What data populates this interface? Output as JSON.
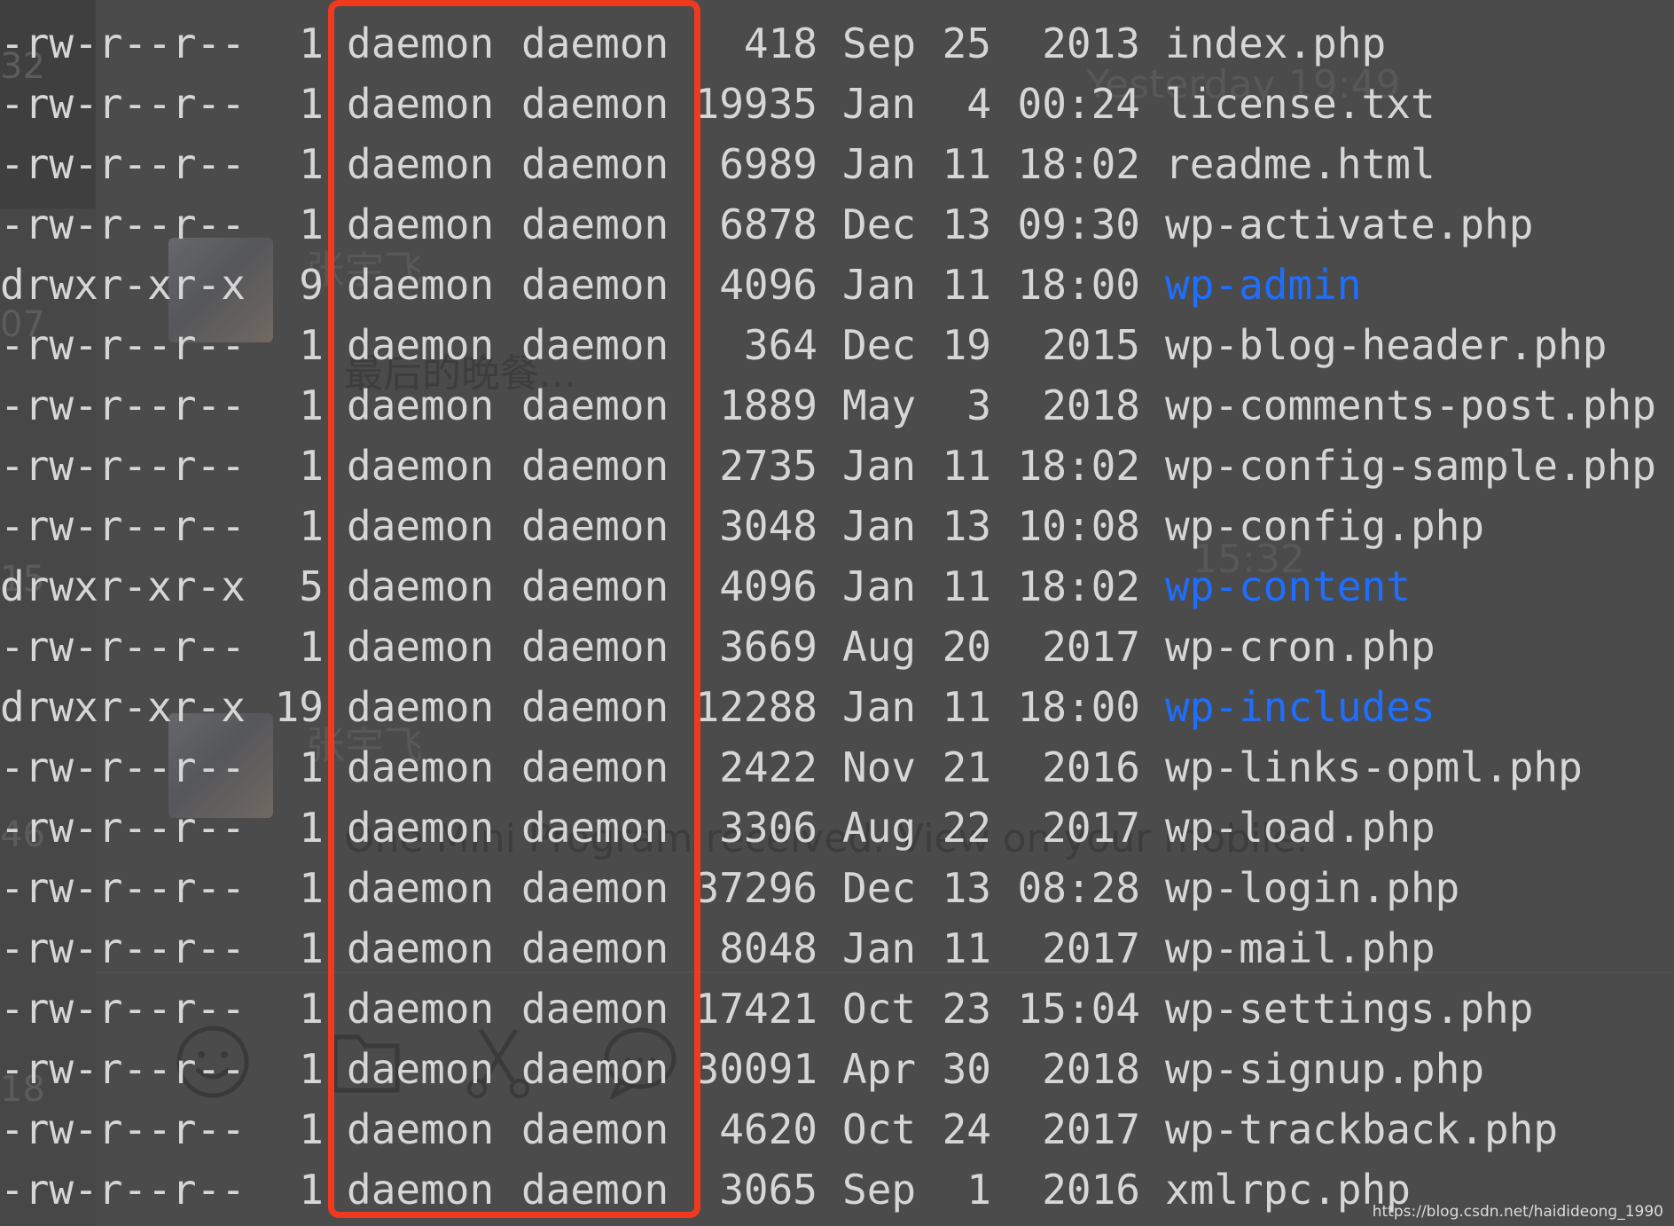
{
  "colors": {
    "background": "#4b4b4b",
    "text": "#d6d6d6",
    "directory": "#1f6fff",
    "highlight_box": "#f0391f"
  },
  "background_ui": {
    "sidebar_numbers": [
      "32",
      "07",
      "15",
      "46",
      "18"
    ],
    "chat_time_1": "Yesterday 19:49",
    "chat_time_2": "15:32",
    "sender_name_1": "张宇飞",
    "sender_name_2": "张宇飞",
    "message_preview": "最后的晚餐...",
    "mini_program_notice": "One Mini Program received. View on your mobile.",
    "toolbar_icons": [
      "emoji-icon",
      "folder-icon",
      "scissors-icon",
      "chat-bubble-icon"
    ]
  },
  "listing": [
    {
      "perm": "-rw-r--r--",
      "links": "1",
      "owner": "daemon",
      "group": "daemon",
      "size": "418",
      "month": "Sep",
      "day": "25",
      "time": "2013",
      "name": "index.php",
      "is_dir": false
    },
    {
      "perm": "-rw-r--r--",
      "links": "1",
      "owner": "daemon",
      "group": "daemon",
      "size": "19935",
      "month": "Jan",
      "day": "4",
      "time": "00:24",
      "name": "license.txt",
      "is_dir": false
    },
    {
      "perm": "-rw-r--r--",
      "links": "1",
      "owner": "daemon",
      "group": "daemon",
      "size": "6989",
      "month": "Jan",
      "day": "11",
      "time": "18:02",
      "name": "readme.html",
      "is_dir": false
    },
    {
      "perm": "-rw-r--r--",
      "links": "1",
      "owner": "daemon",
      "group": "daemon",
      "size": "6878",
      "month": "Dec",
      "day": "13",
      "time": "09:30",
      "name": "wp-activate.php",
      "is_dir": false
    },
    {
      "perm": "drwxr-xr-x",
      "links": "9",
      "owner": "daemon",
      "group": "daemon",
      "size": "4096",
      "month": "Jan",
      "day": "11",
      "time": "18:00",
      "name": "wp-admin",
      "is_dir": true
    },
    {
      "perm": "-rw-r--r--",
      "links": "1",
      "owner": "daemon",
      "group": "daemon",
      "size": "364",
      "month": "Dec",
      "day": "19",
      "time": "2015",
      "name": "wp-blog-header.php",
      "is_dir": false
    },
    {
      "perm": "-rw-r--r--",
      "links": "1",
      "owner": "daemon",
      "group": "daemon",
      "size": "1889",
      "month": "May",
      "day": "3",
      "time": "2018",
      "name": "wp-comments-post.php",
      "is_dir": false
    },
    {
      "perm": "-rw-r--r--",
      "links": "1",
      "owner": "daemon",
      "group": "daemon",
      "size": "2735",
      "month": "Jan",
      "day": "11",
      "time": "18:02",
      "name": "wp-config-sample.php",
      "is_dir": false
    },
    {
      "perm": "-rw-r--r--",
      "links": "1",
      "owner": "daemon",
      "group": "daemon",
      "size": "3048",
      "month": "Jan",
      "day": "13",
      "time": "10:08",
      "name": "wp-config.php",
      "is_dir": false
    },
    {
      "perm": "drwxr-xr-x",
      "links": "5",
      "owner": "daemon",
      "group": "daemon",
      "size": "4096",
      "month": "Jan",
      "day": "11",
      "time": "18:02",
      "name": "wp-content",
      "is_dir": true
    },
    {
      "perm": "-rw-r--r--",
      "links": "1",
      "owner": "daemon",
      "group": "daemon",
      "size": "3669",
      "month": "Aug",
      "day": "20",
      "time": "2017",
      "name": "wp-cron.php",
      "is_dir": false
    },
    {
      "perm": "drwxr-xr-x",
      "links": "19",
      "owner": "daemon",
      "group": "daemon",
      "size": "12288",
      "month": "Jan",
      "day": "11",
      "time": "18:00",
      "name": "wp-includes",
      "is_dir": true
    },
    {
      "perm": "-rw-r--r--",
      "links": "1",
      "owner": "daemon",
      "group": "daemon",
      "size": "2422",
      "month": "Nov",
      "day": "21",
      "time": "2016",
      "name": "wp-links-opml.php",
      "is_dir": false
    },
    {
      "perm": "-rw-r--r--",
      "links": "1",
      "owner": "daemon",
      "group": "daemon",
      "size": "3306",
      "month": "Aug",
      "day": "22",
      "time": "2017",
      "name": "wp-load.php",
      "is_dir": false
    },
    {
      "perm": "-rw-r--r--",
      "links": "1",
      "owner": "daemon",
      "group": "daemon",
      "size": "37296",
      "month": "Dec",
      "day": "13",
      "time": "08:28",
      "name": "wp-login.php",
      "is_dir": false
    },
    {
      "perm": "-rw-r--r--",
      "links": "1",
      "owner": "daemon",
      "group": "daemon",
      "size": "8048",
      "month": "Jan",
      "day": "11",
      "time": "2017",
      "name": "wp-mail.php",
      "is_dir": false
    },
    {
      "perm": "-rw-r--r--",
      "links": "1",
      "owner": "daemon",
      "group": "daemon",
      "size": "17421",
      "month": "Oct",
      "day": "23",
      "time": "15:04",
      "name": "wp-settings.php",
      "is_dir": false
    },
    {
      "perm": "-rw-r--r--",
      "links": "1",
      "owner": "daemon",
      "group": "daemon",
      "size": "30091",
      "month": "Apr",
      "day": "30",
      "time": "2018",
      "name": "wp-signup.php",
      "is_dir": false
    },
    {
      "perm": "-rw-r--r--",
      "links": "1",
      "owner": "daemon",
      "group": "daemon",
      "size": "4620",
      "month": "Oct",
      "day": "24",
      "time": "2017",
      "name": "wp-trackback.php",
      "is_dir": false
    },
    {
      "perm": "-rw-r--r--",
      "links": "1",
      "owner": "daemon",
      "group": "daemon",
      "size": "3065",
      "month": "Sep",
      "day": "1",
      "time": "2016",
      "name": "xmlrpc.php",
      "is_dir": false
    }
  ],
  "watermark": "https://blog.csdn.net/haidideong_1990"
}
